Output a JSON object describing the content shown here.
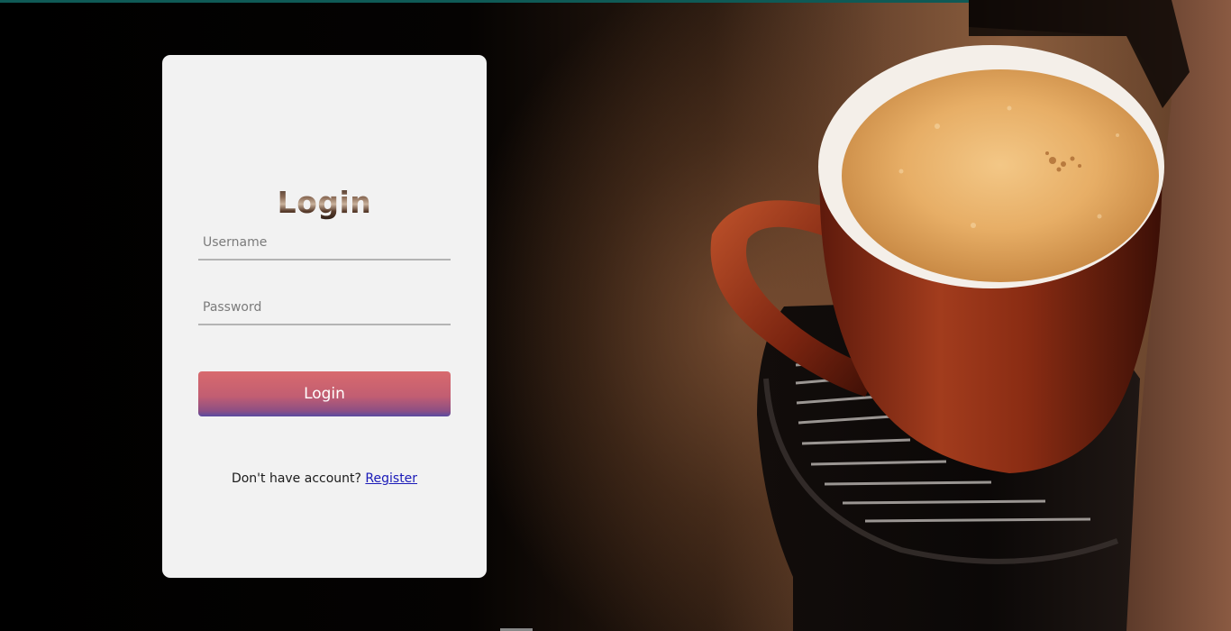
{
  "login_card": {
    "title": "Login",
    "username_placeholder": "Username",
    "password_placeholder": "Password",
    "button_label": "Login",
    "register_prompt": "Don't have account?",
    "register_link": "Register"
  },
  "background": {
    "image_subject": "coffee-cup-on-machine"
  },
  "colors": {
    "button_top": "#d86a6d",
    "button_bottom": "#5a4aa0",
    "card_bg": "#f2f2f2",
    "link": "#1a1ab8",
    "top_strip": "#0f5a56"
  }
}
